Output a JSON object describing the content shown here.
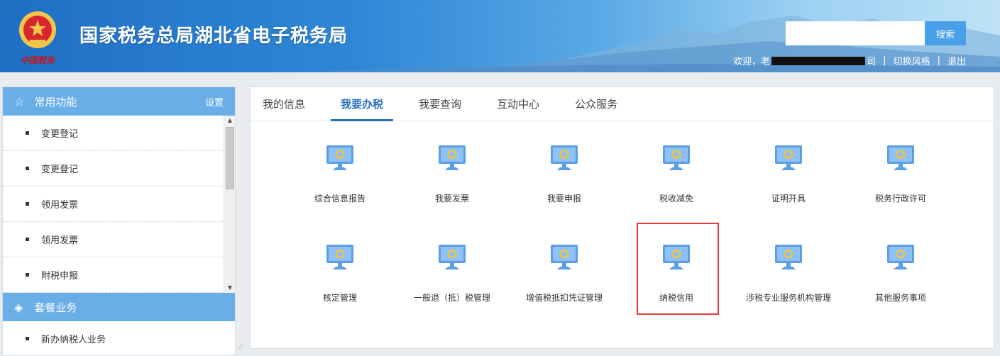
{
  "header": {
    "title": "国家税务总局湖北省电子税务局",
    "emblem_caption": "中国税务",
    "search_placeholder": "",
    "search_label": "搜索",
    "welcome": "欢迎，老",
    "company_tail": "司",
    "switch_style": "切换风格",
    "logout": "退出"
  },
  "sidebar": {
    "common_title": "常用功能",
    "settings_label": "设置",
    "common_items": [
      "变更登记",
      "变更登记",
      "领用发票",
      "领用发票",
      "附税申报"
    ],
    "package_title": "套餐业务",
    "package_items": [
      "新办纳税人业务"
    ]
  },
  "main": {
    "tabs": [
      "我的信息",
      "我要办税",
      "我要查询",
      "互动中心",
      "公众服务"
    ],
    "active_tab": "我要办税",
    "tiles": [
      "综合信息报告",
      "我要发票",
      "我要申报",
      "税收减免",
      "证明开具",
      "税务行政许可",
      "核定管理",
      "一般退（抵）税管理",
      "增值税抵扣凭证管理",
      "纳税信用",
      "涉税专业服务机构管理",
      "其他服务事项"
    ],
    "highlighted_tile": "纳税信用"
  },
  "colors": {
    "accent": "#2a6fbd",
    "sidebar_header": "#6aaee8",
    "highlight": "#e53935"
  }
}
